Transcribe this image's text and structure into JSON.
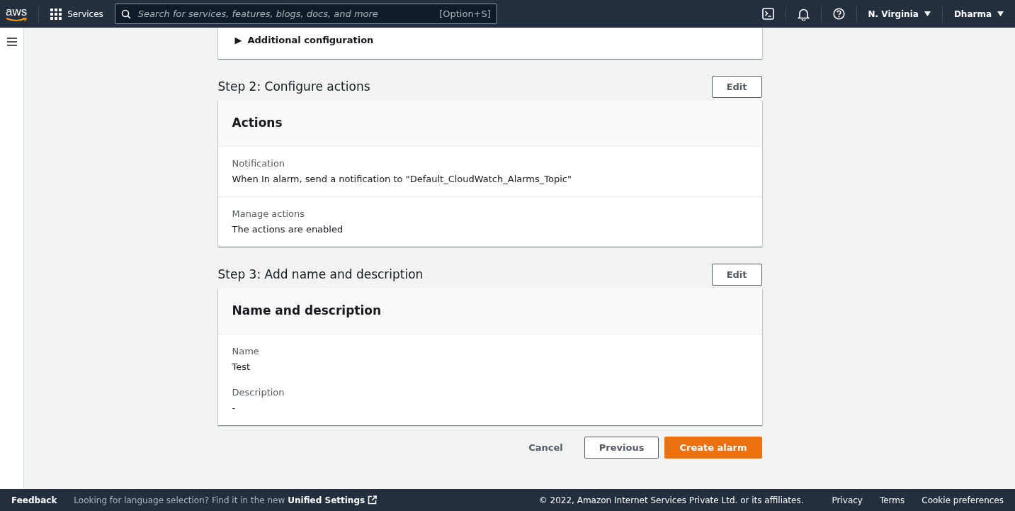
{
  "top_nav": {
    "logo": "aws",
    "services": "Services",
    "search": {
      "placeholder": "Search for services, features, blogs, docs, and more",
      "shortcut": "[Option+S]"
    },
    "region": "N. Virginia",
    "user": "Dharma"
  },
  "previous_section": {
    "expander": "▶",
    "label": "Additional configuration"
  },
  "steps": [
    {
      "title": "Step 2: Configure actions",
      "edit": "Edit",
      "panel_title": "Actions",
      "sections": [
        {
          "fields": [
            {
              "label": "Notification",
              "value": "When In alarm, send a notification to \"Default_CloudWatch_Alarms_Topic\""
            }
          ]
        },
        {
          "fields": [
            {
              "label": "Manage actions",
              "value": "The actions are enabled"
            }
          ]
        }
      ]
    },
    {
      "title": "Step 3: Add name and description",
      "edit": "Edit",
      "panel_title": "Name and description",
      "sections": [
        {
          "fields": [
            {
              "label": "Name",
              "value": "Test"
            },
            {
              "label": "Description",
              "value": "-"
            }
          ]
        }
      ]
    }
  ],
  "actions": {
    "cancel": "Cancel",
    "previous": "Previous",
    "submit": "Create alarm"
  },
  "footer": {
    "feedback": "Feedback",
    "language_note": "Looking for language selection? Find it in the new",
    "unified_settings": "Unified Settings",
    "copyright": "© 2022, Amazon Internet Services Private Ltd. or its affiliates.",
    "links": [
      "Privacy",
      "Terms",
      "Cookie preferences"
    ]
  }
}
